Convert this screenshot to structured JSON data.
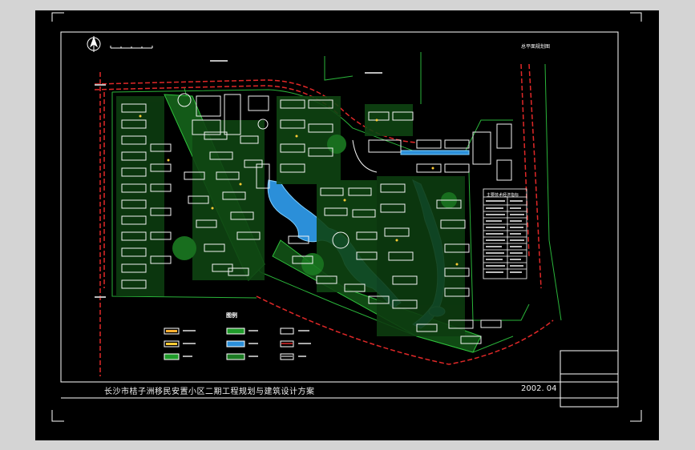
{
  "sheet": {
    "title": "长沙市桔子洲移民安置小区二期工程规划与建筑设计方案",
    "date": "2002. 04",
    "plan_label": "总平面规划图",
    "legend_title": "图例",
    "table_title": "主要技术经济指标"
  },
  "colors": {
    "background": "#000000",
    "frame": "#ffffff",
    "road": "#ff3030",
    "vegetation": "#1faa2a",
    "water": "#40b0ff",
    "building": "#ffffff",
    "accent": "#ffd040"
  },
  "icons": {
    "north_arrow": "north-arrow-icon",
    "scale_bar": "scale-bar-icon"
  }
}
